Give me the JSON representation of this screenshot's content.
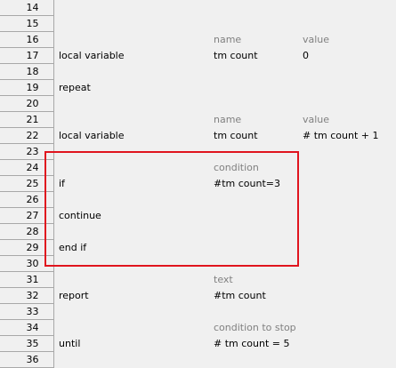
{
  "rows": [
    {
      "num": "14",
      "c1": "",
      "c2": "",
      "c3": "",
      "hdr": false
    },
    {
      "num": "15",
      "c1": "",
      "c2": "",
      "c3": "",
      "hdr": false
    },
    {
      "num": "16",
      "c1": "",
      "c2": "name",
      "c3": "value",
      "hdr": true
    },
    {
      "num": "17",
      "c1": "local variable",
      "c2": "tm count",
      "c3": "0",
      "hdr": false
    },
    {
      "num": "18",
      "c1": "",
      "c2": "",
      "c3": "",
      "hdr": false
    },
    {
      "num": "19",
      "c1": "repeat",
      "c2": "",
      "c3": "",
      "hdr": false
    },
    {
      "num": "20",
      "c1": "",
      "c2": "",
      "c3": "",
      "hdr": false
    },
    {
      "num": "21",
      "c1": "",
      "c2": "name",
      "c3": "value",
      "hdr": true
    },
    {
      "num": "22",
      "c1": "local variable",
      "c2": "tm count",
      "c3": "# tm count + 1",
      "hdr": false
    },
    {
      "num": "23",
      "c1": "",
      "c2": "",
      "c3": "",
      "hdr": false
    },
    {
      "num": "24",
      "c1": "",
      "c2": "condition",
      "c3": "",
      "hdr": true
    },
    {
      "num": "25",
      "c1": "if",
      "c2": "#tm count=3",
      "c3": "",
      "hdr": false
    },
    {
      "num": "26",
      "c1": "",
      "c2": "",
      "c3": "",
      "hdr": false
    },
    {
      "num": "27",
      "c1": "continue",
      "c2": "",
      "c3": "",
      "hdr": false
    },
    {
      "num": "28",
      "c1": "",
      "c2": "",
      "c3": "",
      "hdr": false
    },
    {
      "num": "29",
      "c1": "end if",
      "c2": "",
      "c3": "",
      "hdr": false
    },
    {
      "num": "30",
      "c1": "",
      "c2": "",
      "c3": "",
      "hdr": false
    },
    {
      "num": "31",
      "c1": "",
      "c2": "text",
      "c3": "",
      "hdr": true
    },
    {
      "num": "32",
      "c1": "report",
      "c2": "#tm count",
      "c3": "",
      "hdr": false
    },
    {
      "num": "33",
      "c1": "",
      "c2": "",
      "c3": "",
      "hdr": false
    },
    {
      "num": "34",
      "c1": "",
      "c2": "condition to stop",
      "c3": "",
      "hdr": true
    },
    {
      "num": "35",
      "c1": "until",
      "c2": "# tm count = 5",
      "c3": "",
      "hdr": false
    },
    {
      "num": "36",
      "c1": "",
      "c2": "",
      "c3": "",
      "hdr": false
    }
  ],
  "highlight_color": "#e0141e"
}
